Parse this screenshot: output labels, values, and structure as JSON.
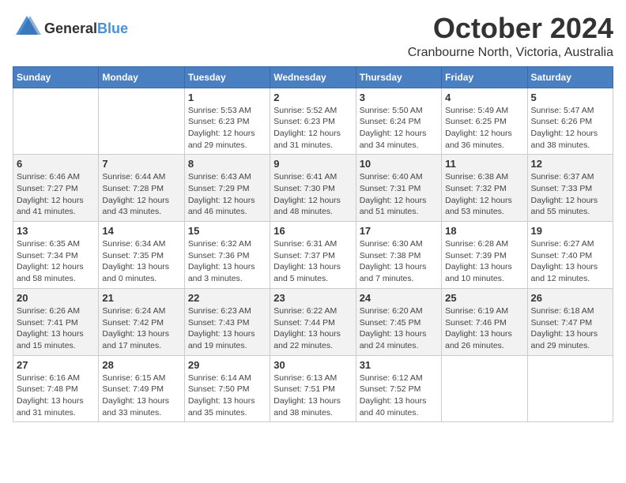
{
  "logo": {
    "general": "General",
    "blue": "Blue"
  },
  "title": "October 2024",
  "location": "Cranbourne North, Victoria, Australia",
  "days_of_week": [
    "Sunday",
    "Monday",
    "Tuesday",
    "Wednesday",
    "Thursday",
    "Friday",
    "Saturday"
  ],
  "weeks": [
    [
      {
        "day": "",
        "info": ""
      },
      {
        "day": "",
        "info": ""
      },
      {
        "day": "1",
        "info": "Sunrise: 5:53 AM\nSunset: 6:23 PM\nDaylight: 12 hours and 29 minutes."
      },
      {
        "day": "2",
        "info": "Sunrise: 5:52 AM\nSunset: 6:23 PM\nDaylight: 12 hours and 31 minutes."
      },
      {
        "day": "3",
        "info": "Sunrise: 5:50 AM\nSunset: 6:24 PM\nDaylight: 12 hours and 34 minutes."
      },
      {
        "day": "4",
        "info": "Sunrise: 5:49 AM\nSunset: 6:25 PM\nDaylight: 12 hours and 36 minutes."
      },
      {
        "day": "5",
        "info": "Sunrise: 5:47 AM\nSunset: 6:26 PM\nDaylight: 12 hours and 38 minutes."
      }
    ],
    [
      {
        "day": "6",
        "info": "Sunrise: 6:46 AM\nSunset: 7:27 PM\nDaylight: 12 hours and 41 minutes."
      },
      {
        "day": "7",
        "info": "Sunrise: 6:44 AM\nSunset: 7:28 PM\nDaylight: 12 hours and 43 minutes."
      },
      {
        "day": "8",
        "info": "Sunrise: 6:43 AM\nSunset: 7:29 PM\nDaylight: 12 hours and 46 minutes."
      },
      {
        "day": "9",
        "info": "Sunrise: 6:41 AM\nSunset: 7:30 PM\nDaylight: 12 hours and 48 minutes."
      },
      {
        "day": "10",
        "info": "Sunrise: 6:40 AM\nSunset: 7:31 PM\nDaylight: 12 hours and 51 minutes."
      },
      {
        "day": "11",
        "info": "Sunrise: 6:38 AM\nSunset: 7:32 PM\nDaylight: 12 hours and 53 minutes."
      },
      {
        "day": "12",
        "info": "Sunrise: 6:37 AM\nSunset: 7:33 PM\nDaylight: 12 hours and 55 minutes."
      }
    ],
    [
      {
        "day": "13",
        "info": "Sunrise: 6:35 AM\nSunset: 7:34 PM\nDaylight: 12 hours and 58 minutes."
      },
      {
        "day": "14",
        "info": "Sunrise: 6:34 AM\nSunset: 7:35 PM\nDaylight: 13 hours and 0 minutes."
      },
      {
        "day": "15",
        "info": "Sunrise: 6:32 AM\nSunset: 7:36 PM\nDaylight: 13 hours and 3 minutes."
      },
      {
        "day": "16",
        "info": "Sunrise: 6:31 AM\nSunset: 7:37 PM\nDaylight: 13 hours and 5 minutes."
      },
      {
        "day": "17",
        "info": "Sunrise: 6:30 AM\nSunset: 7:38 PM\nDaylight: 13 hours and 7 minutes."
      },
      {
        "day": "18",
        "info": "Sunrise: 6:28 AM\nSunset: 7:39 PM\nDaylight: 13 hours and 10 minutes."
      },
      {
        "day": "19",
        "info": "Sunrise: 6:27 AM\nSunset: 7:40 PM\nDaylight: 13 hours and 12 minutes."
      }
    ],
    [
      {
        "day": "20",
        "info": "Sunrise: 6:26 AM\nSunset: 7:41 PM\nDaylight: 13 hours and 15 minutes."
      },
      {
        "day": "21",
        "info": "Sunrise: 6:24 AM\nSunset: 7:42 PM\nDaylight: 13 hours and 17 minutes."
      },
      {
        "day": "22",
        "info": "Sunrise: 6:23 AM\nSunset: 7:43 PM\nDaylight: 13 hours and 19 minutes."
      },
      {
        "day": "23",
        "info": "Sunrise: 6:22 AM\nSunset: 7:44 PM\nDaylight: 13 hours and 22 minutes."
      },
      {
        "day": "24",
        "info": "Sunrise: 6:20 AM\nSunset: 7:45 PM\nDaylight: 13 hours and 24 minutes."
      },
      {
        "day": "25",
        "info": "Sunrise: 6:19 AM\nSunset: 7:46 PM\nDaylight: 13 hours and 26 minutes."
      },
      {
        "day": "26",
        "info": "Sunrise: 6:18 AM\nSunset: 7:47 PM\nDaylight: 13 hours and 29 minutes."
      }
    ],
    [
      {
        "day": "27",
        "info": "Sunrise: 6:16 AM\nSunset: 7:48 PM\nDaylight: 13 hours and 31 minutes."
      },
      {
        "day": "28",
        "info": "Sunrise: 6:15 AM\nSunset: 7:49 PM\nDaylight: 13 hours and 33 minutes."
      },
      {
        "day": "29",
        "info": "Sunrise: 6:14 AM\nSunset: 7:50 PM\nDaylight: 13 hours and 35 minutes."
      },
      {
        "day": "30",
        "info": "Sunrise: 6:13 AM\nSunset: 7:51 PM\nDaylight: 13 hours and 38 minutes."
      },
      {
        "day": "31",
        "info": "Sunrise: 6:12 AM\nSunset: 7:52 PM\nDaylight: 13 hours and 40 minutes."
      },
      {
        "day": "",
        "info": ""
      },
      {
        "day": "",
        "info": ""
      }
    ]
  ]
}
